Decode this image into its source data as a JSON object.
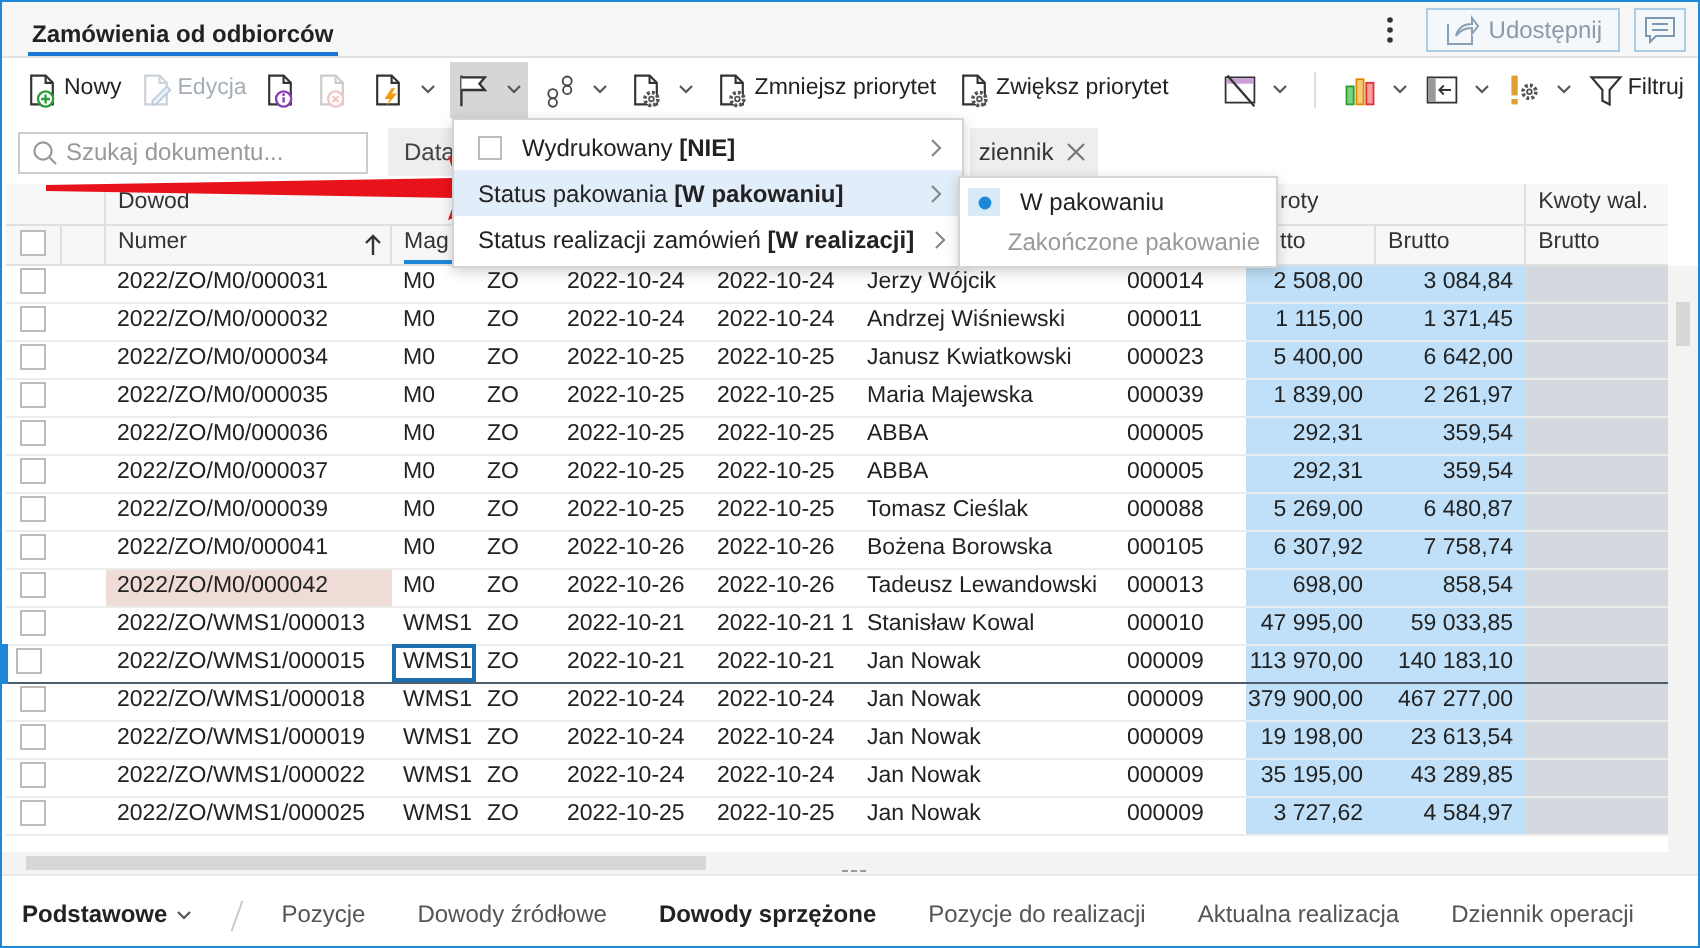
{
  "header": {
    "tab": {
      "label": "Zamówienia od odbiorców",
      "selected": true
    },
    "share_button": {
      "label": "Udostępnij",
      "disabled": true
    }
  },
  "toolbar": {
    "left": [
      {
        "label": "Nowy",
        "disabled": false,
        "dropdown": false,
        "expanded": false
      },
      {
        "label": "Edycja",
        "disabled": true,
        "dropdown": false,
        "expanded": false
      },
      {
        "disabled": false,
        "dropdown": false,
        "expanded": false
      },
      {
        "disabled": true,
        "dropdown": false,
        "expanded": false
      },
      {
        "disabled": false,
        "dropdown": true,
        "expanded": false
      },
      {
        "disabled": false,
        "dropdown": true,
        "expanded": true
      },
      {
        "disabled": false,
        "dropdown": true,
        "expanded": false
      },
      {
        "disabled": false,
        "dropdown": true,
        "expanded": false
      },
      {
        "label": "Zmniejsz priorytet",
        "disabled": false,
        "dropdown": false,
        "expanded": false
      },
      {
        "label": "Zwiększ priorytet",
        "disabled": false,
        "dropdown": false,
        "expanded": false
      }
    ],
    "right": [
      {
        "disabled": false,
        "dropdown": true,
        "expanded": false
      },
      {
        "disabled": false,
        "dropdown": true,
        "expanded": false
      },
      {
        "disabled": false,
        "dropdown": true,
        "expanded": false
      },
      {
        "disabled": false,
        "dropdown": true,
        "expanded": false
      },
      {
        "label": "Filtruj",
        "disabled": false,
        "dropdown": false,
        "expanded": false
      }
    ]
  },
  "filters": {
    "search": {
      "placeholder": "Szukaj dokumentu..."
    },
    "date_button": "Data",
    "chip": "ziennik"
  },
  "menu": {
    "items": [
      {
        "kind": "checkbox",
        "label": "Wydrukowany **[NIE]**",
        "checked": false,
        "selected": false
      },
      {
        "kind": "submenu",
        "label": "Status pakowania **[W pakowaniu]**",
        "selected": true
      },
      {
        "kind": "submenu",
        "label": "Status realizacji zamówień **[W realizacji]**",
        "selected": false
      }
    ],
    "submenu": [
      {
        "label": "W pakowaniu",
        "selected": true,
        "disabled": false
      },
      {
        "label": "Zakończone pakowanie",
        "selected": false,
        "disabled": true
      }
    ]
  },
  "table": {
    "column_groups": [
      {
        "label": "Dowod"
      },
      {
        "label": "roty"
      },
      {
        "label": "Kwoty wal."
      }
    ],
    "columns": [
      {
        "label": "Numer",
        "sorted": true,
        "focused": false
      },
      {
        "label": "Mag",
        "sorted": false,
        "focused": true
      },
      {},
      {},
      {},
      {},
      {},
      {
        "label": "tto",
        "sorted": false,
        "focused": false
      },
      {
        "label": "Brutto",
        "sorted": false,
        "focused": false
      },
      {
        "label": "Brutto",
        "sorted": false,
        "focused": false
      }
    ],
    "header_checkbox": {
      "checked": false
    },
    "rows": [
      {
        "selected": false,
        "checked": false,
        "cells": [
          "2022/ZO/M0/000031",
          "M0",
          "ZO",
          "2022-10-24",
          "2022-10-24",
          "Jerzy Wójcik",
          "000014",
          "2 508,00",
          "3 084,84"
        ]
      },
      {
        "selected": false,
        "checked": false,
        "cells": [
          "2022/ZO/M0/000032",
          "M0",
          "ZO",
          "2022-10-24",
          "2022-10-24",
          "Andrzej Wiśniewski",
          "000011",
          "1 115,00",
          "1 371,45"
        ]
      },
      {
        "selected": false,
        "checked": false,
        "cells": [
          "2022/ZO/M0/000034",
          "M0",
          "ZO",
          "2022-10-25",
          "2022-10-25",
          "Janusz Kwiatkowski",
          "000023",
          "5 400,00",
          "6 642,00"
        ]
      },
      {
        "selected": false,
        "checked": false,
        "cells": [
          "2022/ZO/M0/000035",
          "M0",
          "ZO",
          "2022-10-25",
          "2022-10-25",
          "Maria Majewska",
          "000039",
          "1 839,00",
          "2 261,97"
        ]
      },
      {
        "selected": false,
        "checked": false,
        "cells": [
          "2022/ZO/M0/000036",
          "M0",
          "ZO",
          "2022-10-25",
          "2022-10-25",
          "ABBA",
          "000005",
          "292,31",
          "359,54"
        ]
      },
      {
        "selected": false,
        "checked": false,
        "cells": [
          "2022/ZO/M0/000037",
          "M0",
          "ZO",
          "2022-10-25",
          "2022-10-25",
          "ABBA",
          "000005",
          "292,31",
          "359,54"
        ]
      },
      {
        "selected": false,
        "checked": false,
        "cells": [
          "2022/ZO/M0/000039",
          "M0",
          "ZO",
          "2022-10-25",
          "2022-10-25",
          "Tomasz Cieślak",
          "000088",
          "5 269,00",
          "6 480,87"
        ]
      },
      {
        "selected": false,
        "checked": false,
        "cells": [
          "2022/ZO/M0/000041",
          "M0",
          "ZO",
          "2022-10-26",
          "2022-10-26",
          "Bożena Borowska",
          "000105",
          "6 307,92",
          "7 758,74"
        ]
      },
      {
        "selected": false,
        "checked": false,
        "cells": [
          {
            "text": "2022/ZO/M0/000042",
            "highlighted": true
          },
          "M0",
          "ZO",
          "2022-10-26",
          "2022-10-26",
          "Tadeusz Lewandowski",
          "000013",
          "698,00",
          "858,54"
        ]
      },
      {
        "selected": false,
        "checked": false,
        "cells": [
          "2022/ZO/WMS1/000013",
          "WMS1",
          "ZO",
          "2022-10-21",
          "2022-10-21 1",
          "Stanisław Kowal",
          "000010",
          "47 995,00",
          "59 033,85"
        ]
      },
      {
        "selected": true,
        "checked": false,
        "cells": [
          "2022/ZO/WMS1/000015",
          {
            "text": "WMS1",
            "focused": true
          },
          "ZO",
          "2022-10-21",
          "2022-10-21",
          "Jan Nowak",
          "000009",
          "113 970,00",
          "140 183,10"
        ]
      },
      {
        "selected": false,
        "checked": false,
        "cells": [
          "2022/ZO/WMS1/000018",
          "WMS1",
          "ZO",
          "2022-10-24",
          "2022-10-24",
          "Jan Nowak",
          "000009",
          "379 900,00",
          "467 277,00"
        ]
      },
      {
        "selected": false,
        "checked": false,
        "cells": [
          "2022/ZO/WMS1/000019",
          "WMS1",
          "ZO",
          "2022-10-24",
          "2022-10-24",
          "Jan Nowak",
          "000009",
          "19 198,00",
          "23 613,54"
        ]
      },
      {
        "selected": false,
        "checked": false,
        "cells": [
          "2022/ZO/WMS1/000022",
          "WMS1",
          "ZO",
          "2022-10-24",
          "2022-10-24",
          "Jan Nowak",
          "000009",
          "35 195,00",
          "43 289,85"
        ]
      },
      {
        "selected": false,
        "checked": false,
        "cells": [
          "2022/ZO/WMS1/000025",
          "WMS1",
          "ZO",
          "2022-10-25",
          "2022-10-25",
          "Jan Nowak",
          "000009",
          "3 727,62",
          "4 584,97"
        ]
      }
    ]
  },
  "bottom_tabs": [
    {
      "label": "Podstawowe",
      "kind": "dropdown"
    },
    {
      "label": "Pozycje",
      "kind": "tab",
      "selected": false
    },
    {
      "label": "Dowody źródłowe",
      "kind": "tab",
      "selected": false
    },
    {
      "label": "Dowody sprzężone",
      "kind": "tab",
      "selected": true
    },
    {
      "label": "Pozycje do realizacji",
      "kind": "tab",
      "selected": false
    },
    {
      "label": "Aktualna realizacja",
      "kind": "tab",
      "selected": false
    },
    {
      "label": "Dziennik operacji",
      "kind": "tab",
      "selected": false
    }
  ]
}
